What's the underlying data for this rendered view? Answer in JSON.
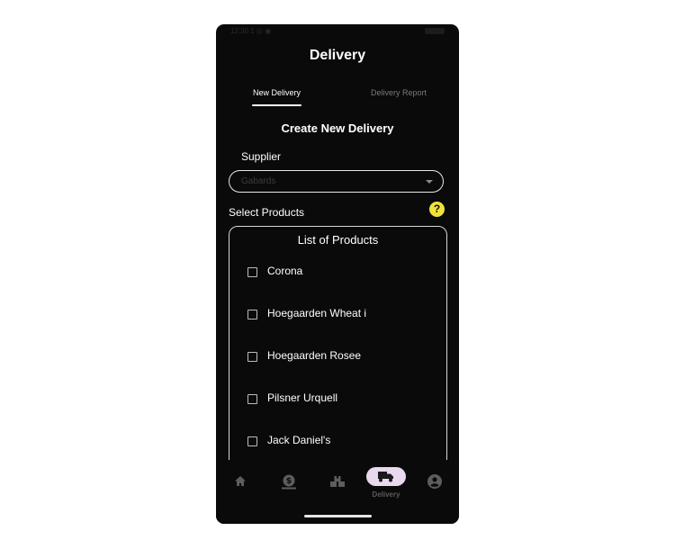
{
  "status_bar": {
    "time": "12:30 1 ◎ ◉"
  },
  "header": {
    "title": "Delivery"
  },
  "tabs": [
    {
      "label": "New Delivery",
      "active": true
    },
    {
      "label": "Delivery Report",
      "active": false
    }
  ],
  "form": {
    "title": "Create New Delivery",
    "supplier_label": "Supplier",
    "supplier_value": "Gabards",
    "select_products_label": "Select Products",
    "help_icon": "?"
  },
  "products": {
    "title": "List of Products",
    "items": [
      {
        "label": "Corona",
        "checked": false
      },
      {
        "label": "Hoegaarden Wheat i",
        "checked": false
      },
      {
        "label": "Hoegaarden Rosee",
        "checked": false
      },
      {
        "label": "Pilsner Urquell",
        "checked": false
      },
      {
        "label": "Jack Daniel's",
        "checked": false
      }
    ]
  },
  "bottom_nav": {
    "items": [
      {
        "icon": "home-icon"
      },
      {
        "icon": "money-icon"
      },
      {
        "icon": "inventory-icon"
      },
      {
        "icon": "truck-icon",
        "label": "Delivery",
        "active": true
      },
      {
        "icon": "account-icon"
      }
    ]
  },
  "colors": {
    "background": "#0a0a0a",
    "accent": "#e9d9ee",
    "help": "#f0e23a"
  }
}
